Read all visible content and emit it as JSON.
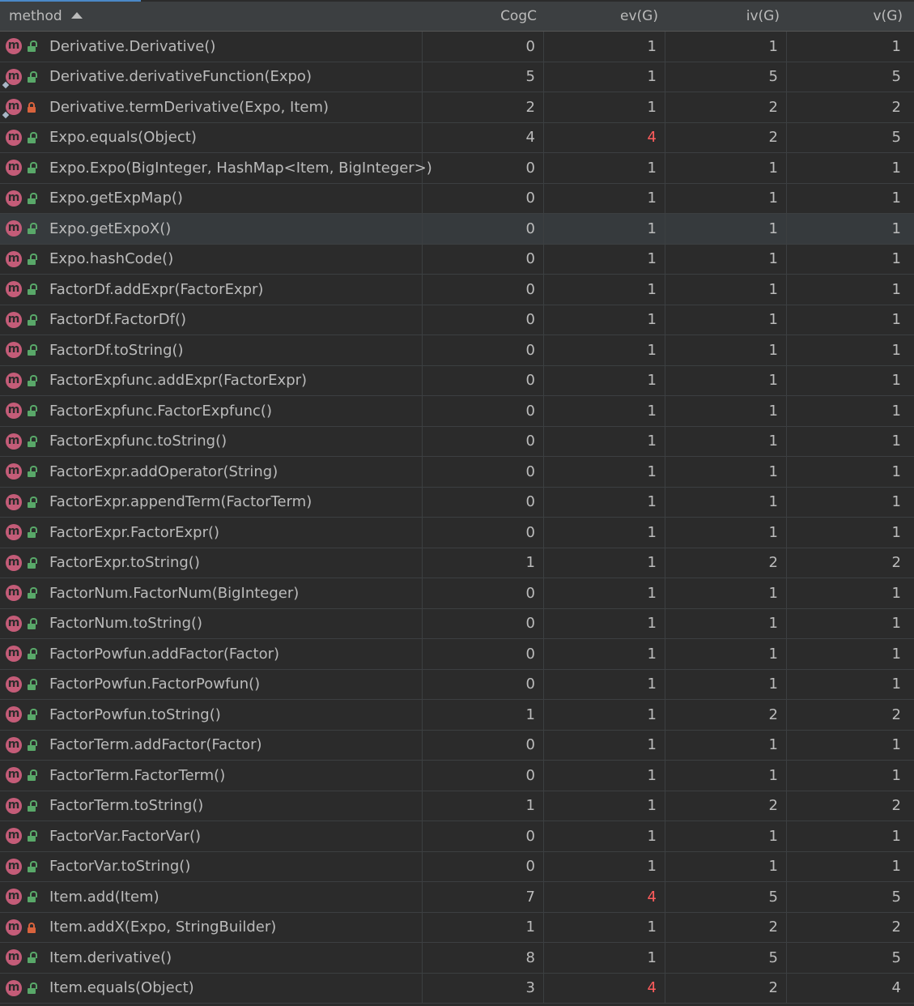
{
  "columns": {
    "method": "method",
    "cogc": "CogC",
    "ev": "ev(G)",
    "iv": "iv(G)",
    "v": "v(G)"
  },
  "colors": {
    "warning": "#ff5c5c",
    "method_icon": "#c45c78",
    "public_lock": "#59a869",
    "private_lock": "#d9633d"
  },
  "rows": [
    {
      "method": "Derivative.Derivative()",
      "cogc": "0",
      "ev": "1",
      "iv": "1",
      "v": "1",
      "visibility": "public",
      "mark": false,
      "ev_warn": false
    },
    {
      "method": "Derivative.derivativeFunction(Expo)",
      "cogc": "5",
      "ev": "1",
      "iv": "5",
      "v": "5",
      "visibility": "public",
      "mark": true,
      "ev_warn": false
    },
    {
      "method": "Derivative.termDerivative(Expo, Item)",
      "cogc": "2",
      "ev": "1",
      "iv": "2",
      "v": "2",
      "visibility": "private",
      "mark": true,
      "ev_warn": false
    },
    {
      "method": "Expo.equals(Object)",
      "cogc": "4",
      "ev": "4",
      "iv": "2",
      "v": "5",
      "visibility": "public",
      "mark": false,
      "ev_warn": true
    },
    {
      "method": "Expo.Expo(BigInteger, HashMap<Item, BigInteger>)",
      "cogc": "0",
      "ev": "1",
      "iv": "1",
      "v": "1",
      "visibility": "public",
      "mark": false,
      "ev_warn": false
    },
    {
      "method": "Expo.getExpMap()",
      "cogc": "0",
      "ev": "1",
      "iv": "1",
      "v": "1",
      "visibility": "public",
      "mark": false,
      "ev_warn": false
    },
    {
      "method": "Expo.getExpoX()",
      "cogc": "0",
      "ev": "1",
      "iv": "1",
      "v": "1",
      "visibility": "public",
      "mark": false,
      "ev_warn": false,
      "selected": true
    },
    {
      "method": "Expo.hashCode()",
      "cogc": "0",
      "ev": "1",
      "iv": "1",
      "v": "1",
      "visibility": "public",
      "mark": false,
      "ev_warn": false
    },
    {
      "method": "FactorDf.addExpr(FactorExpr)",
      "cogc": "0",
      "ev": "1",
      "iv": "1",
      "v": "1",
      "visibility": "public",
      "mark": false,
      "ev_warn": false
    },
    {
      "method": "FactorDf.FactorDf()",
      "cogc": "0",
      "ev": "1",
      "iv": "1",
      "v": "1",
      "visibility": "public",
      "mark": false,
      "ev_warn": false
    },
    {
      "method": "FactorDf.toString()",
      "cogc": "0",
      "ev": "1",
      "iv": "1",
      "v": "1",
      "visibility": "public",
      "mark": false,
      "ev_warn": false
    },
    {
      "method": "FactorExpfunc.addExpr(FactorExpr)",
      "cogc": "0",
      "ev": "1",
      "iv": "1",
      "v": "1",
      "visibility": "public",
      "mark": false,
      "ev_warn": false
    },
    {
      "method": "FactorExpfunc.FactorExpfunc()",
      "cogc": "0",
      "ev": "1",
      "iv": "1",
      "v": "1",
      "visibility": "public",
      "mark": false,
      "ev_warn": false
    },
    {
      "method": "FactorExpfunc.toString()",
      "cogc": "0",
      "ev": "1",
      "iv": "1",
      "v": "1",
      "visibility": "public",
      "mark": false,
      "ev_warn": false
    },
    {
      "method": "FactorExpr.addOperator(String)",
      "cogc": "0",
      "ev": "1",
      "iv": "1",
      "v": "1",
      "visibility": "public",
      "mark": false,
      "ev_warn": false
    },
    {
      "method": "FactorExpr.appendTerm(FactorTerm)",
      "cogc": "0",
      "ev": "1",
      "iv": "1",
      "v": "1",
      "visibility": "public",
      "mark": false,
      "ev_warn": false
    },
    {
      "method": "FactorExpr.FactorExpr()",
      "cogc": "0",
      "ev": "1",
      "iv": "1",
      "v": "1",
      "visibility": "public",
      "mark": false,
      "ev_warn": false
    },
    {
      "method": "FactorExpr.toString()",
      "cogc": "1",
      "ev": "1",
      "iv": "2",
      "v": "2",
      "visibility": "public",
      "mark": false,
      "ev_warn": false
    },
    {
      "method": "FactorNum.FactorNum(BigInteger)",
      "cogc": "0",
      "ev": "1",
      "iv": "1",
      "v": "1",
      "visibility": "public",
      "mark": false,
      "ev_warn": false
    },
    {
      "method": "FactorNum.toString()",
      "cogc": "0",
      "ev": "1",
      "iv": "1",
      "v": "1",
      "visibility": "public",
      "mark": false,
      "ev_warn": false
    },
    {
      "method": "FactorPowfun.addFactor(Factor)",
      "cogc": "0",
      "ev": "1",
      "iv": "1",
      "v": "1",
      "visibility": "public",
      "mark": false,
      "ev_warn": false
    },
    {
      "method": "FactorPowfun.FactorPowfun()",
      "cogc": "0",
      "ev": "1",
      "iv": "1",
      "v": "1",
      "visibility": "public",
      "mark": false,
      "ev_warn": false
    },
    {
      "method": "FactorPowfun.toString()",
      "cogc": "1",
      "ev": "1",
      "iv": "2",
      "v": "2",
      "visibility": "public",
      "mark": false,
      "ev_warn": false
    },
    {
      "method": "FactorTerm.addFactor(Factor)",
      "cogc": "0",
      "ev": "1",
      "iv": "1",
      "v": "1",
      "visibility": "public",
      "mark": false,
      "ev_warn": false
    },
    {
      "method": "FactorTerm.FactorTerm()",
      "cogc": "0",
      "ev": "1",
      "iv": "1",
      "v": "1",
      "visibility": "public",
      "mark": false,
      "ev_warn": false
    },
    {
      "method": "FactorTerm.toString()",
      "cogc": "1",
      "ev": "1",
      "iv": "2",
      "v": "2",
      "visibility": "public",
      "mark": false,
      "ev_warn": false
    },
    {
      "method": "FactorVar.FactorVar()",
      "cogc": "0",
      "ev": "1",
      "iv": "1",
      "v": "1",
      "visibility": "public",
      "mark": false,
      "ev_warn": false
    },
    {
      "method": "FactorVar.toString()",
      "cogc": "0",
      "ev": "1",
      "iv": "1",
      "v": "1",
      "visibility": "public",
      "mark": false,
      "ev_warn": false
    },
    {
      "method": "Item.add(Item)",
      "cogc": "7",
      "ev": "4",
      "iv": "5",
      "v": "5",
      "visibility": "public",
      "mark": false,
      "ev_warn": true
    },
    {
      "method": "Item.addX(Expo, StringBuilder)",
      "cogc": "1",
      "ev": "1",
      "iv": "2",
      "v": "2",
      "visibility": "private",
      "mark": false,
      "ev_warn": false
    },
    {
      "method": "Item.derivative()",
      "cogc": "8",
      "ev": "1",
      "iv": "5",
      "v": "5",
      "visibility": "public",
      "mark": false,
      "ev_warn": false
    },
    {
      "method": "Item.equals(Object)",
      "cogc": "3",
      "ev": "4",
      "iv": "2",
      "v": "4",
      "visibility": "public",
      "mark": false,
      "ev_warn": true
    }
  ]
}
